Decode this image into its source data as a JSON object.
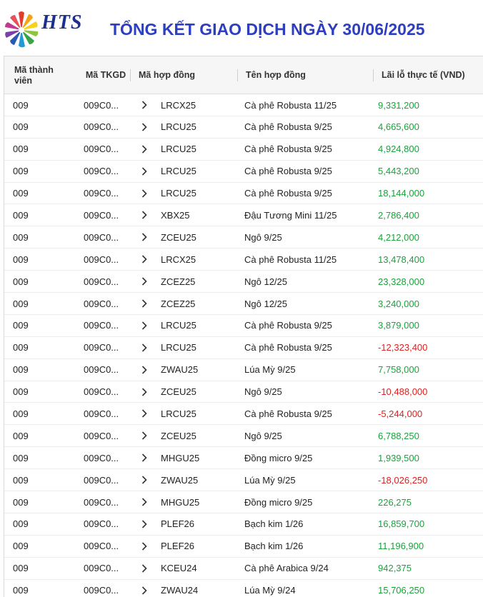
{
  "brand": {
    "logo_text": "HTS"
  },
  "page": {
    "title": "TỔNG KẾT GIAO DỊCH NGÀY 30/06/2025"
  },
  "colors": {
    "title": "#2e3ec0",
    "logo_text": "#1c2f8c",
    "positive": "#1aa33a",
    "negative": "#e02020"
  },
  "table": {
    "headers": [
      "Mã thành viên",
      "Mã TKGD",
      "Mã hợp đồng",
      "Tên hợp đồng",
      "Lãi lỗ thực tế (VND)"
    ],
    "rows": [
      {
        "member": "009",
        "account": "009C0...",
        "code": "LRCX25",
        "name": "Cà phê Robusta 11/25",
        "pnl": "9,331,200",
        "sign": "pos"
      },
      {
        "member": "009",
        "account": "009C0...",
        "code": "LRCU25",
        "name": "Cà phê Robusta 9/25",
        "pnl": "4,665,600",
        "sign": "pos"
      },
      {
        "member": "009",
        "account": "009C0...",
        "code": "LRCU25",
        "name": "Cà phê Robusta 9/25",
        "pnl": "4,924,800",
        "sign": "pos"
      },
      {
        "member": "009",
        "account": "009C0...",
        "code": "LRCU25",
        "name": "Cà phê Robusta 9/25",
        "pnl": "5,443,200",
        "sign": "pos"
      },
      {
        "member": "009",
        "account": "009C0...",
        "code": "LRCU25",
        "name": "Cà phê Robusta 9/25",
        "pnl": "18,144,000",
        "sign": "pos"
      },
      {
        "member": "009",
        "account": "009C0...",
        "code": "XBX25",
        "name": "Đậu Tương Mini 11/25",
        "pnl": "2,786,400",
        "sign": "pos"
      },
      {
        "member": "009",
        "account": "009C0...",
        "code": "ZCEU25",
        "name": "Ngô 9/25",
        "pnl": "4,212,000",
        "sign": "pos"
      },
      {
        "member": "009",
        "account": "009C0...",
        "code": "LRCX25",
        "name": "Cà phê Robusta 11/25",
        "pnl": "13,478,400",
        "sign": "pos"
      },
      {
        "member": "009",
        "account": "009C0...",
        "code": "ZCEZ25",
        "name": "Ngô 12/25",
        "pnl": "23,328,000",
        "sign": "pos"
      },
      {
        "member": "009",
        "account": "009C0...",
        "code": "ZCEZ25",
        "name": "Ngô 12/25",
        "pnl": "3,240,000",
        "sign": "pos"
      },
      {
        "member": "009",
        "account": "009C0...",
        "code": "LRCU25",
        "name": "Cà phê Robusta 9/25",
        "pnl": "3,879,000",
        "sign": "pos"
      },
      {
        "member": "009",
        "account": "009C0...",
        "code": "LRCU25",
        "name": "Cà phê Robusta 9/25",
        "pnl": "-12,323,400",
        "sign": "neg"
      },
      {
        "member": "009",
        "account": "009C0...",
        "code": "ZWAU25",
        "name": "Lúa Mỳ 9/25",
        "pnl": "7,758,000",
        "sign": "pos"
      },
      {
        "member": "009",
        "account": "009C0...",
        "code": "ZCEU25",
        "name": "Ngô 9/25",
        "pnl": "-10,488,000",
        "sign": "neg"
      },
      {
        "member": "009",
        "account": "009C0...",
        "code": "LRCU25",
        "name": "Cà phê Robusta 9/25",
        "pnl": "-5,244,000",
        "sign": "neg"
      },
      {
        "member": "009",
        "account": "009C0...",
        "code": "ZCEU25",
        "name": "Ngô 9/25",
        "pnl": "6,788,250",
        "sign": "pos"
      },
      {
        "member": "009",
        "account": "009C0...",
        "code": "MHGU25",
        "name": "Đồng micro 9/25",
        "pnl": "1,939,500",
        "sign": "pos"
      },
      {
        "member": "009",
        "account": "009C0...",
        "code": "ZWAU25",
        "name": "Lúa Mỳ 9/25",
        "pnl": "-18,026,250",
        "sign": "neg"
      },
      {
        "member": "009",
        "account": "009C0...",
        "code": "MHGU25",
        "name": "Đồng micro 9/25",
        "pnl": "226,275",
        "sign": "pos"
      },
      {
        "member": "009",
        "account": "009C0...",
        "code": "PLEF26",
        "name": "Bạch kim 1/26",
        "pnl": "16,859,700",
        "sign": "pos"
      },
      {
        "member": "009",
        "account": "009C0...",
        "code": "PLEF26",
        "name": "Bạch kim 1/26",
        "pnl": "11,196,900",
        "sign": "pos"
      },
      {
        "member": "009",
        "account": "009C0...",
        "code": "KCEU24",
        "name": "Cà phê Arabica 9/24",
        "pnl": "942,375",
        "sign": "pos"
      },
      {
        "member": "009",
        "account": "009C0...",
        "code": "ZWAU24",
        "name": "Lúa Mỳ 9/24",
        "pnl": "15,706,250",
        "sign": "pos"
      }
    ]
  }
}
